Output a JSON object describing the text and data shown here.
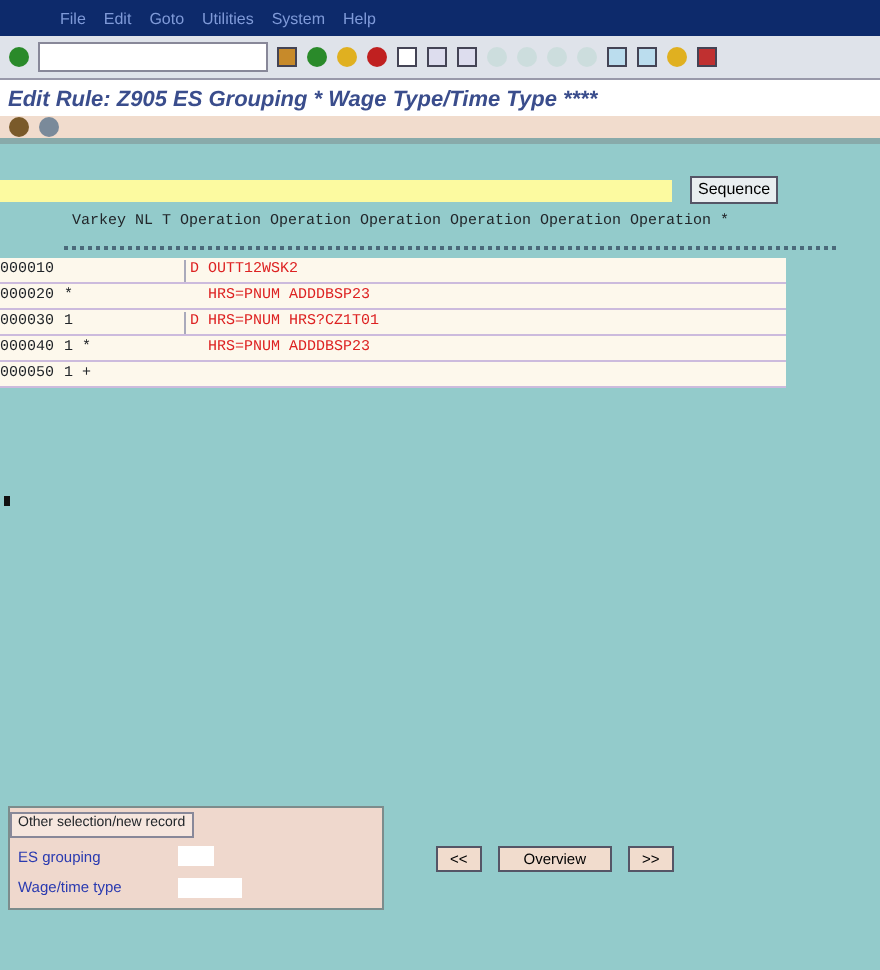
{
  "menu": [
    "File",
    "Edit",
    "Goto",
    "Utilities",
    "System",
    "Help"
  ],
  "title": "Edit Rule: Z905 ES Grouping * Wage Type/Time Type ****",
  "sequence_button": "Sequence",
  "table": {
    "header": "Varkey  NL T Operation Operation Operation Operation Operation Operation *",
    "rows": [
      {
        "line": "000010",
        "marker": "D",
        "operation": "OUTT12WSK2"
      },
      {
        "line": "000020",
        "varkey": "*",
        "operation": "HRS=PNUM  ADDDBSP23"
      },
      {
        "line": "000030",
        "varkey": "1",
        "marker": "D",
        "operation": "HRS=PNUM  HRS?CZ1T01"
      },
      {
        "line": "000040",
        "varkey": "1 *",
        "operation": "HRS=PNUM  ADDDBSP23"
      },
      {
        "line": "000050",
        "varkey": "1 +"
      }
    ]
  },
  "selection_panel": {
    "title": "Other selection/new record",
    "fields": [
      {
        "label": "ES grouping"
      },
      {
        "label": "Wage/time type"
      }
    ]
  },
  "buttons": [
    "<<",
    "Overview",
    ">>"
  ]
}
